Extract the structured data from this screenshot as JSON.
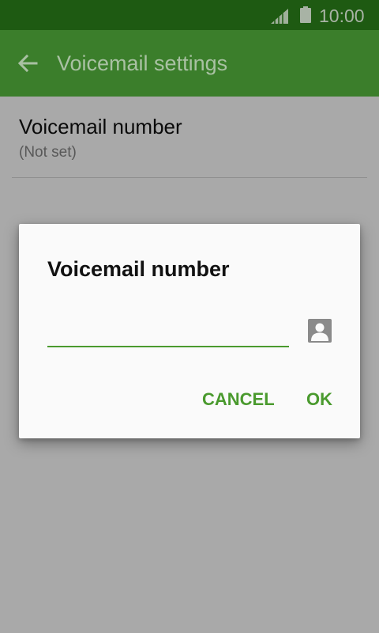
{
  "status_bar": {
    "time": "10:00",
    "icons": [
      "signal-icon",
      "battery-icon"
    ]
  },
  "app_bar": {
    "title": "Voicemail settings",
    "back_icon": "arrow-back-icon"
  },
  "settings": {
    "items": [
      {
        "title": "Voicemail number",
        "summary": "(Not set)"
      }
    ]
  },
  "dialog": {
    "title": "Voicemail number",
    "input": {
      "value": "",
      "placeholder": ""
    },
    "contact_icon": "contact-picker-icon",
    "cancel_label": "CANCEL",
    "ok_label": "OK"
  },
  "colors": {
    "status_bar": "#1e5a12",
    "app_bar": "#3b7e2b",
    "accent": "#4a9a2e",
    "scrim_background": "#a9a9a9",
    "dialog_background": "#fafafa"
  }
}
